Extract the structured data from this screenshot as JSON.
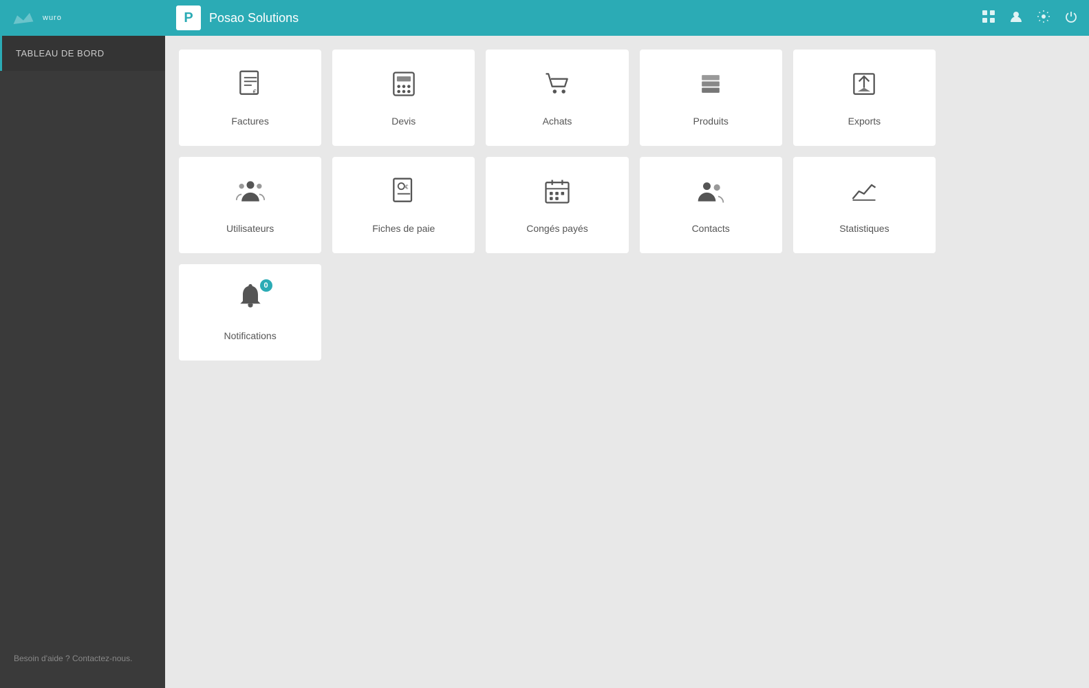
{
  "header": {
    "logo_text": "wuro",
    "brand_logo": "P",
    "brand_title": "Posao Solutions",
    "nav_icons": [
      "grid-icon",
      "user-icon",
      "settings-icon",
      "power-icon"
    ]
  },
  "sidebar": {
    "items": [
      {
        "label": "Tableau de bord",
        "active": true
      }
    ],
    "help_text": "Besoin d'aide ? Contactez-nous."
  },
  "tiles": [
    {
      "id": "factures",
      "label": "Factures",
      "icon": "invoice"
    },
    {
      "id": "devis",
      "label": "Devis",
      "icon": "calculator"
    },
    {
      "id": "achats",
      "label": "Achats",
      "icon": "cart"
    },
    {
      "id": "produits",
      "label": "Produits",
      "icon": "stack"
    },
    {
      "id": "exports",
      "label": "Exports",
      "icon": "export"
    },
    {
      "id": "utilisateurs",
      "label": "Utilisateurs",
      "icon": "users"
    },
    {
      "id": "fiches-de-paie",
      "label": "Fiches de paie",
      "icon": "payslip"
    },
    {
      "id": "conges-payes",
      "label": "Congés payés",
      "icon": "calendar"
    },
    {
      "id": "contacts",
      "label": "Contacts",
      "icon": "contacts"
    },
    {
      "id": "statistiques",
      "label": "Statistiques",
      "icon": "stats"
    },
    {
      "id": "notifications",
      "label": "Notifications",
      "icon": "bell",
      "badge": "0"
    }
  ],
  "colors": {
    "accent": "#2BABB5",
    "sidebar_bg": "#3a3a3a",
    "tile_bg": "#ffffff",
    "icon_color": "#555555"
  }
}
